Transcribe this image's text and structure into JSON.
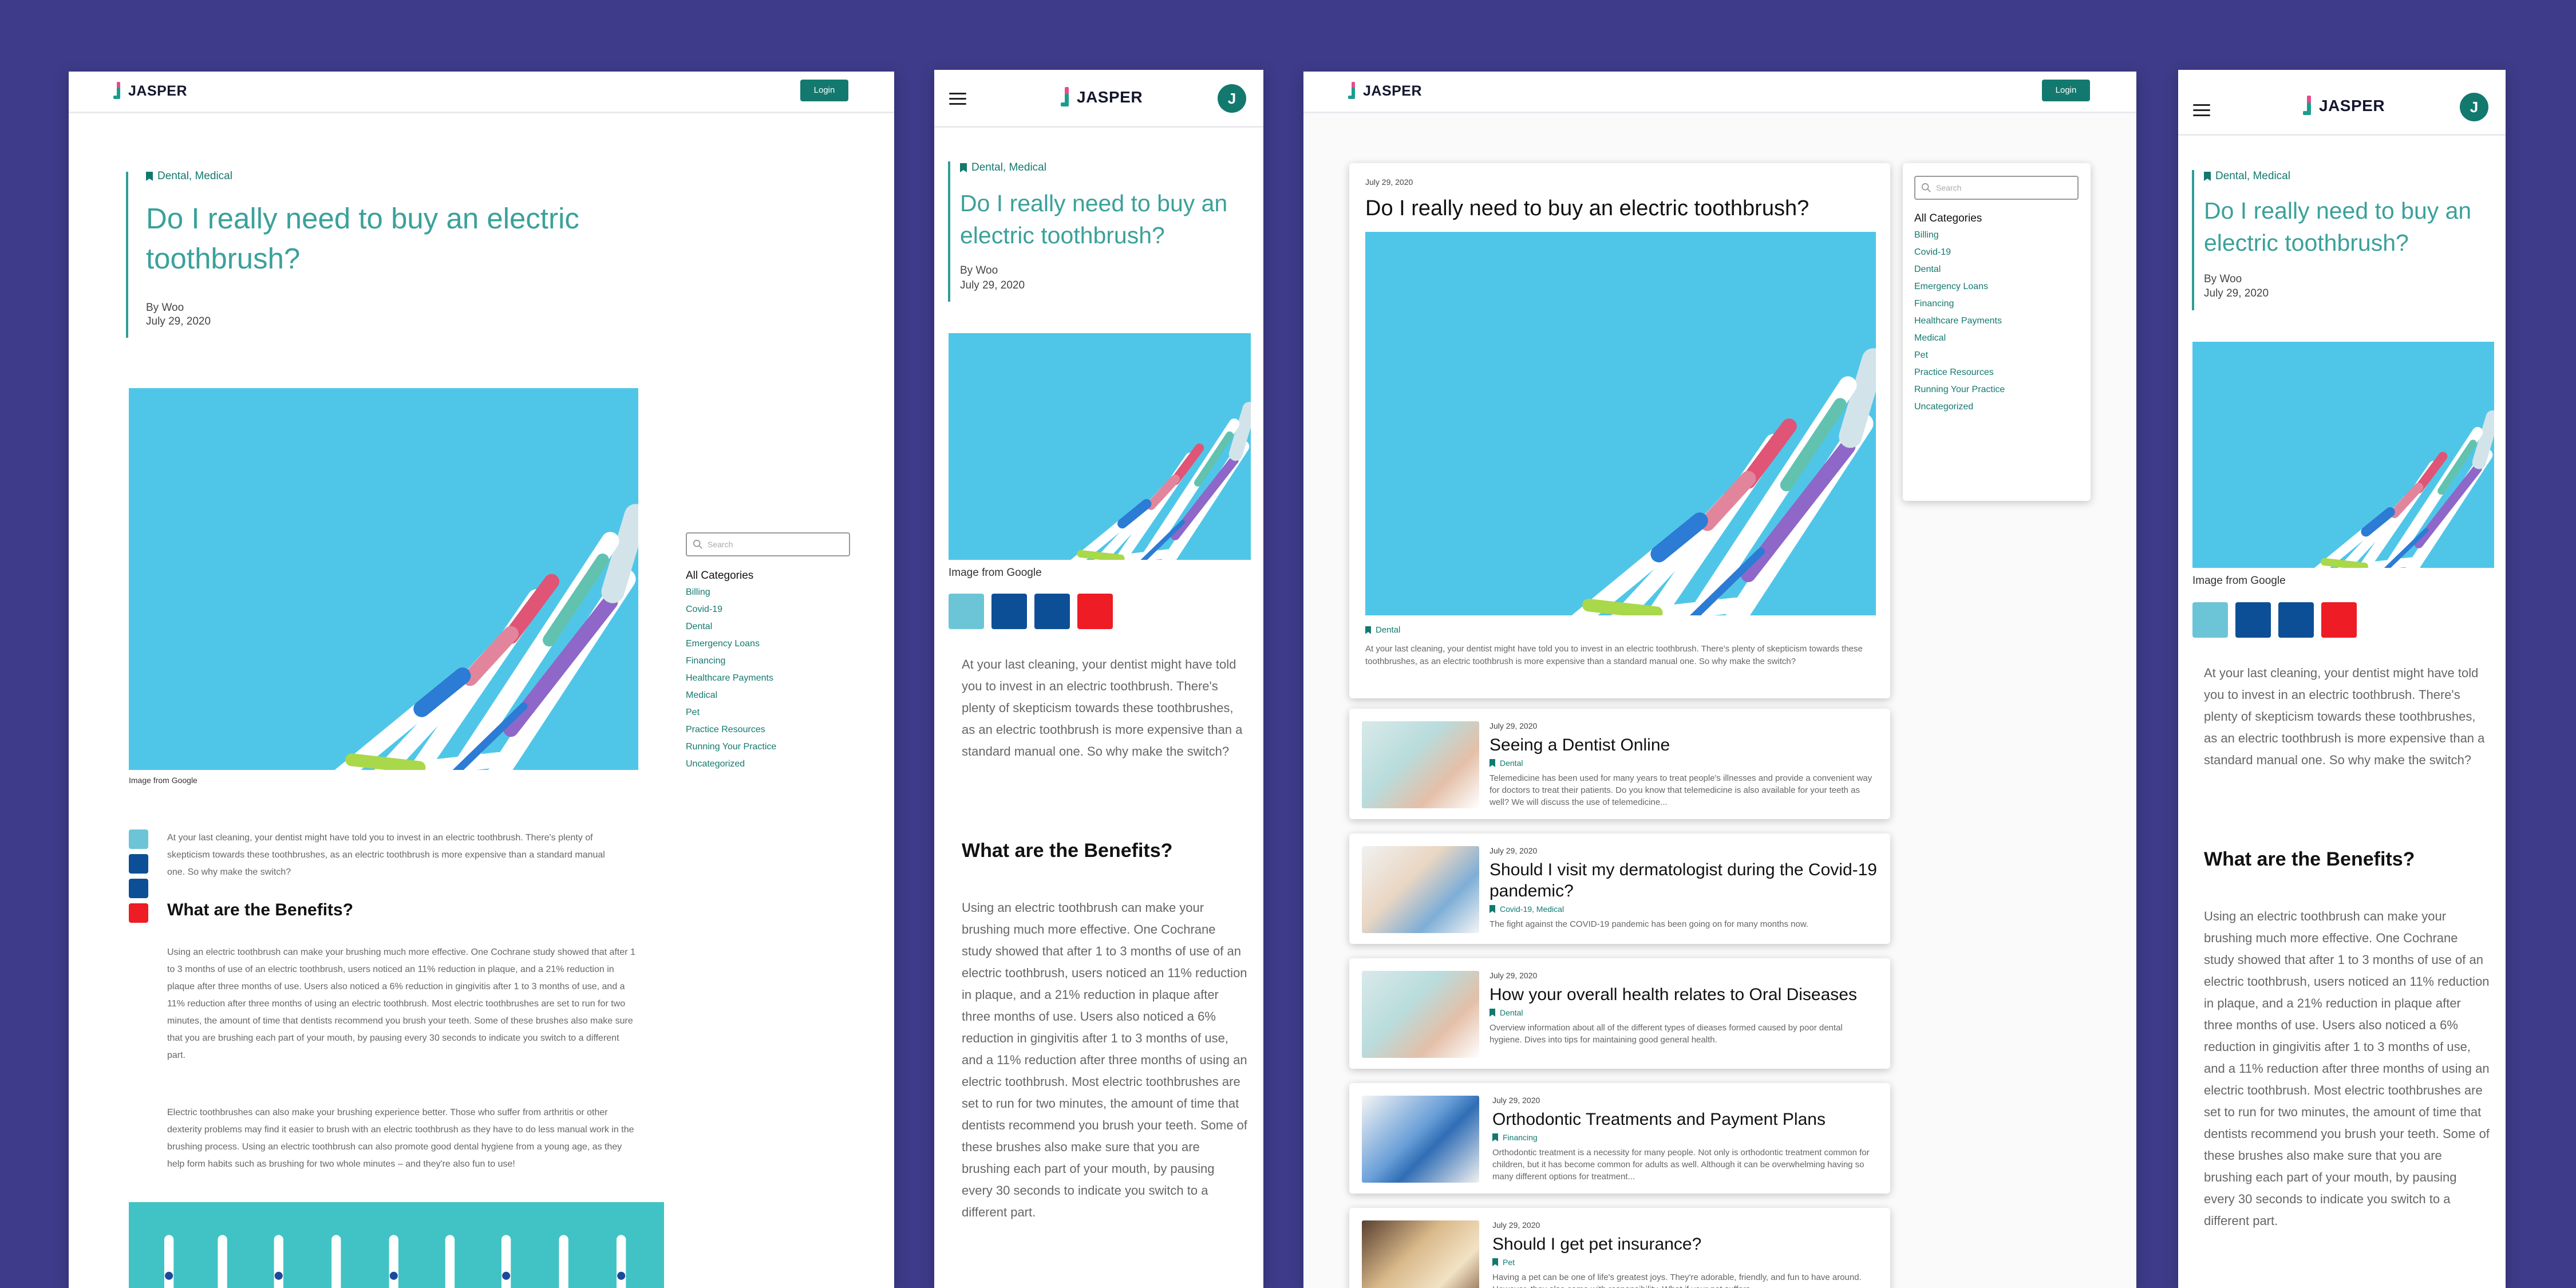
{
  "brand": "JASPER",
  "login_label": "Login",
  "avatar_initial": "J",
  "post": {
    "categories": "Dental, Medical",
    "title": "Do I really need to buy an electric toothbrush?",
    "author": "By Woo",
    "date": "July 29, 2020",
    "image_caption": "Image from Google",
    "intro": "At your last cleaning, your dentist might have told you to invest in an electric toothbrush. There's plenty of skepticism towards these toothbrushes, as an electric toothbrush is more expensive than a standard manual one. So why make the switch?",
    "h2": "What are the Benefits?",
    "benefits_p1": "Using an electric toothbrush can make your brushing much more effective. One Cochrane study showed that after 1 to 3 months of use of an electric toothbrush, users noticed an 11% reduction in plaque, and a 21% reduction in plaque after three months of use. Users also noticed a 6% reduction in gingivitis after 1 to 3 months of use, and a 11% reduction after three months of using an electric toothbrush. Most electric toothbrushes are set to run for two minutes, the amount of time that dentists recommend you brush your teeth. Some of these brushes also make sure that you are brushing each part of your mouth, by pausing every 30 seconds to indicate you switch to a different part.",
    "benefits_p2": "Electric toothbrushes can also make your brushing experience better. Those who suffer from arthritis or other dexterity problems may find it easier to brush with an electric toothbrush as they have to do less manual work in the brushing process. Using an electric toothbrush can also promote good dental hygiene from a young age, as they help form habits such as brushing for two whole minutes – and they're also fun to use!",
    "card_category": "Dental"
  },
  "palette": [
    "#6cc5d6",
    "#0d4f96",
    "#0d4f96",
    "#ee1c24"
  ],
  "sidebar": {
    "search_placeholder": "Search",
    "heading": "All Categories",
    "categories": [
      "Billing",
      "Covid-19",
      "Dental",
      "Emergency Loans",
      "Financing",
      "Healthcare Payments",
      "Medical",
      "Pet",
      "Practice Resources",
      "Running Your Practice",
      "Uncategorized"
    ]
  },
  "blog_list": [
    {
      "date": "July 29, 2020",
      "title": "Seeing a Dentist Online",
      "category": "Dental",
      "excerpt": "Telemedicine has been used for many years to treat people's illnesses and provide a convenient way for doctors to treat their patients. Do you know that telemedicine is also available for your teeth as well? We will discuss the use of telemedicine..."
    },
    {
      "date": "July 29, 2020",
      "title": "Should I visit my dermatologist during the Covid-19 pandemic?",
      "category": "Covid-19, Medical",
      "excerpt": "The fight against the COVID-19 pandemic has been going on for many months now."
    },
    {
      "date": "July 29, 2020",
      "title": "How your overall health relates to Oral Diseases",
      "category": "Dental",
      "excerpt": "Overview information about all of the different types of dieases formed caused by poor dental hygiene. Dives into tips for maintaining good general health."
    },
    {
      "date": "July 29, 2020",
      "title": "Orthodontic Treatments and Payment Plans",
      "category": "Financing",
      "excerpt": "Orthodontic treatment is a necessity for many people. Not only is orthodontic treatment common for children, but it has become common for adults as well. Although it can be overwhelming having so many different options for treatment..."
    },
    {
      "date": "July 29, 2020",
      "title": "Should I get pet insurance?",
      "category": "Pet",
      "excerpt": "Having a pet can be one of life's greatest joys. They're adorable, friendly, and fun to have around. However, they also come with responsibility. What if your pet suffers..."
    }
  ]
}
